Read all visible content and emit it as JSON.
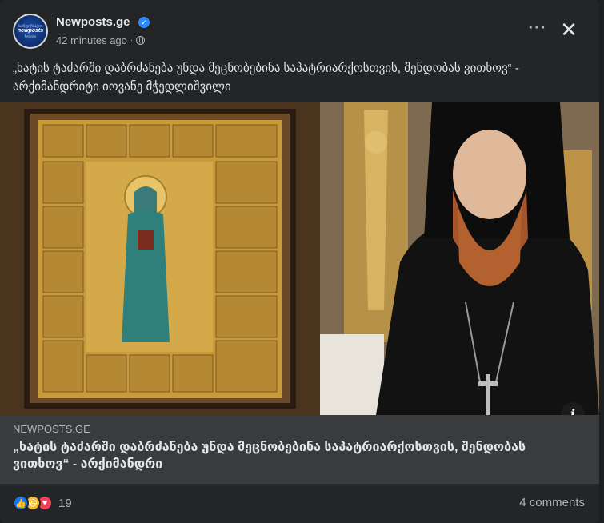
{
  "post": {
    "page_name": "Newposts.ge",
    "time": "42 minutes ago",
    "caption": "„ხატის ტაძარში დაბრძანება უნდა მეცნობებინა საპატრიარქოსთვის, შენდობას ვითხოვ“ - არქიმანდრიტი იოვანე მჭედლიშვილი",
    "avatar_text": {
      "top": "საინფორმაციო",
      "mid": "newposts",
      "bot": "ნიუსები"
    }
  },
  "link_preview": {
    "domain": "NEWPOSTS.GE",
    "title": "„ხატის ტაძარში დაბრძანება უნდა მეცნობებინა საპატრიარქოსთვის, შენდობას ვითხოვ“ - არქიმანდრი"
  },
  "footer": {
    "reaction_count": "19",
    "comments_label": "4 comments"
  },
  "icons": {
    "more": "more-options-icon",
    "close": "close-icon",
    "verified": "verified-badge-icon",
    "audience": "globe-icon",
    "info": "info-icon"
  },
  "colors": {
    "background": "#242526",
    "link_preview": "#3a3b3c",
    "like": "#1877f2",
    "haha": "#f7b928",
    "love": "#f33e58",
    "verified": "#2d88ff"
  }
}
